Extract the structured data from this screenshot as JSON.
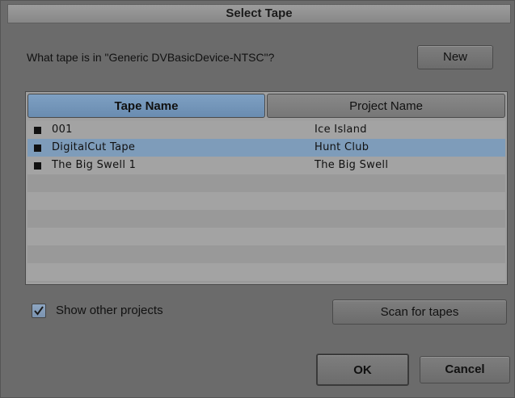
{
  "dialog": {
    "title": "Select Tape",
    "prompt": "What tape is in \"Generic DVBasicDevice-NTSC\"?",
    "new_label": "New"
  },
  "table": {
    "columns": [
      "Tape Name",
      "Project Name"
    ],
    "rows": [
      {
        "tape": "001",
        "project": "Ice Island",
        "selected": false
      },
      {
        "tape": "DigitalCut Tape",
        "project": "Hunt Club",
        "selected": true
      },
      {
        "tape": "The Big Swell 1",
        "project": "The Big Swell",
        "selected": false
      }
    ]
  },
  "options": {
    "show_other_label": "Show other projects",
    "show_other_checked": true,
    "scan_label": "Scan for tapes"
  },
  "actions": {
    "ok_label": "OK",
    "cancel_label": "Cancel"
  },
  "colors": {
    "selection": "#7e9cba",
    "active_header": "#7ea0c3"
  }
}
